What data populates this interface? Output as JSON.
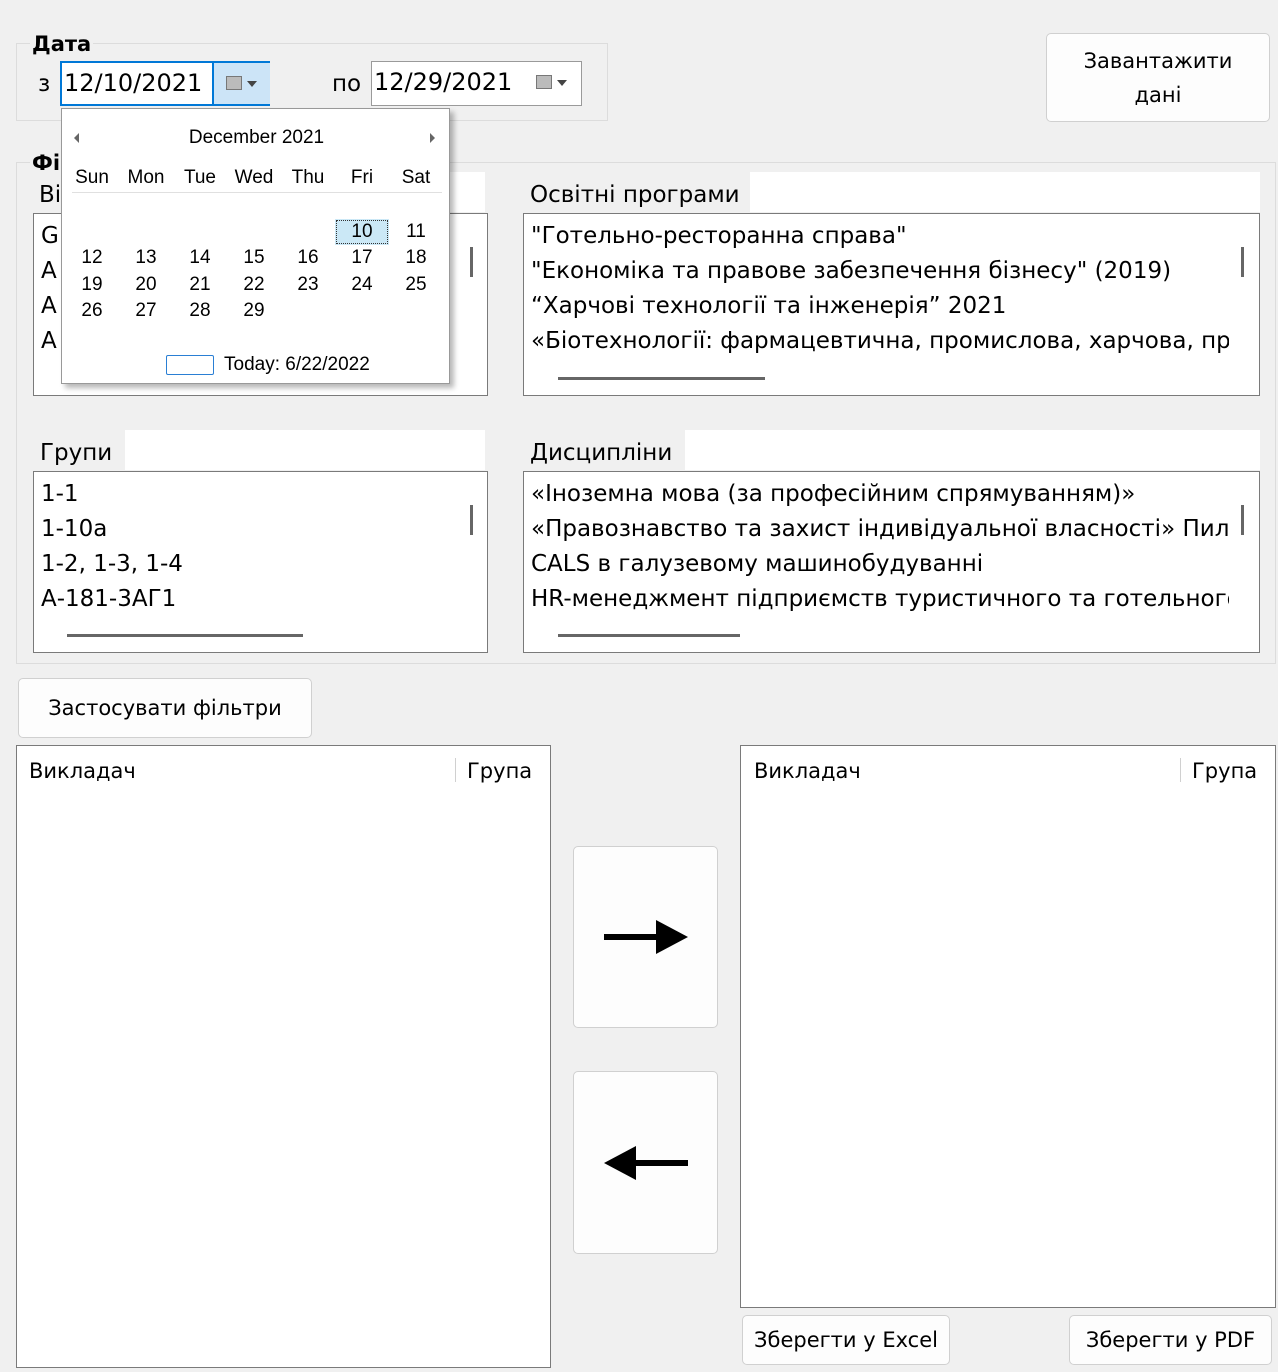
{
  "date_group": {
    "legend": "Дата",
    "from_label": "з",
    "from_value": "12/10/2021",
    "to_label": "по",
    "to_value": "12/29/2021",
    "icon": "calendar-dropdown-icon"
  },
  "load_button": {
    "line1": "Завантажити",
    "line2": "дані"
  },
  "filters_group": {
    "legend": "Фі",
    "teachers": {
      "label": "Ві",
      "items": [
        "G",
        "A",
        "A",
        "A"
      ]
    },
    "programs": {
      "label": "Освітні програми",
      "filter_value": "",
      "items": [
        "\"Готельно-ресторанна справа\"",
        "\"Економіка та правове забезпечення бізнесу\" (2019)",
        "“Харчові технології та інженерія” 2021",
        "«Біотехнології: фармацевтична, промислова, харчова, пр"
      ]
    },
    "groups": {
      "label": "Групи",
      "filter_value": "",
      "items": [
        "1-1",
        "1-10а",
        "1-2, 1-3, 1-4",
        "А-181-3АГ1"
      ]
    },
    "disciplines": {
      "label": "Дисципліни",
      "filter_value": "",
      "items": [
        "«Іноземна мова (за професійним спрямуванням)»",
        "«Правознавство та захист індивідуальної власності» Пил",
        "CALS в галузевому машинобудуванні",
        "HR-менеджмент підприємств туристичного та готельного"
      ]
    }
  },
  "apply_button": "Застосувати фільтри",
  "left_grid": {
    "col1": "Викладач",
    "col2": "Група"
  },
  "right_grid": {
    "col1": "Викладач",
    "col2": "Група"
  },
  "move_right_icon": "arrow-right-icon",
  "move_left_icon": "arrow-left-icon",
  "save_excel": "Зберегти у Excel",
  "save_pdf": "Зберегти у PDF",
  "calendar": {
    "month_title": "December 2021",
    "weekdays": [
      "Sun",
      "Mon",
      "Tue",
      "Wed",
      "Thu",
      "Fri",
      "Sat"
    ],
    "weeks": [
      [
        "",
        "",
        "",
        "",
        "",
        "10",
        "11"
      ],
      [
        "12",
        "13",
        "14",
        "15",
        "16",
        "17",
        "18"
      ],
      [
        "19",
        "20",
        "21",
        "22",
        "23",
        "24",
        "25"
      ],
      [
        "26",
        "27",
        "28",
        "29",
        "",
        "",
        ""
      ]
    ],
    "selected_day": "10",
    "today_text": "Today: 6/22/2022",
    "prev_icon": "triangle-left-icon",
    "next_icon": "triangle-right-icon"
  }
}
